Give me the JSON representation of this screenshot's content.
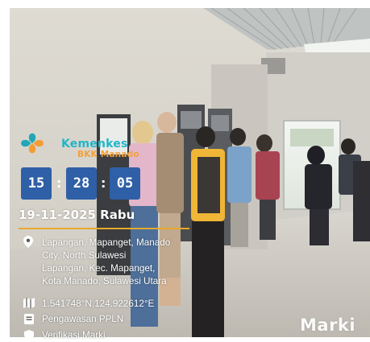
{
  "brand": {
    "line1": "Kemenkes",
    "line2": "BKK Manado"
  },
  "time": {
    "hours": "15",
    "minutes": "28",
    "seconds": "05",
    "separator": ":"
  },
  "date": "19-11-2025 Rabu",
  "location": {
    "icon": "map-pin-icon",
    "lines": [
      "Lapangan, Mapanget, Manado",
      "City, North Sulawesi",
      "Lapangan, Kec. Mapanget,",
      "Kota Manado, Sulawesi Utara"
    ]
  },
  "coordinates": {
    "icon": "map-icon",
    "text": "1.541748°N,124.922612°E"
  },
  "note": {
    "icon": "note-icon",
    "text": "Pengawasan PPLN"
  },
  "verification": {
    "icon": "shield-check-icon",
    "text": "Verifikasi Marki"
  },
  "watermark": "Marki",
  "colors": {
    "time_box": "#2f5fa6",
    "rule": "#e8a92a",
    "brand_teal": "#21b5c9",
    "brand_orange": "#f3a13a"
  }
}
